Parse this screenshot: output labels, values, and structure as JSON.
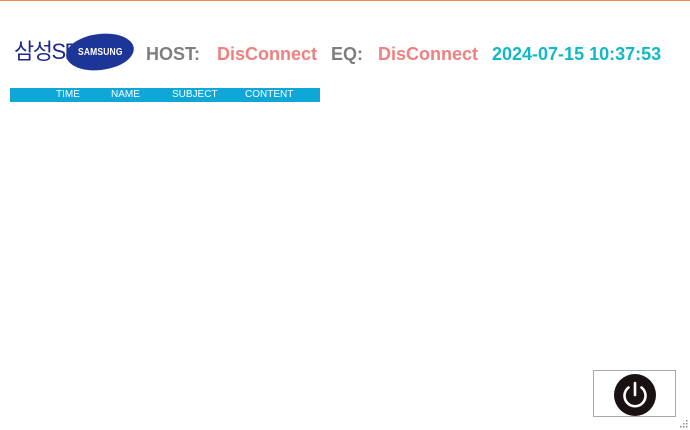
{
  "logos": {
    "company_logo_text": "삼성SDI",
    "brand_logo_text": "SAMSUNG"
  },
  "status": {
    "host_label": "HOST:",
    "host_value": "DisConnect",
    "eq_label": "EQ:",
    "eq_value": "DisConnect",
    "datetime": "2024-07-15 10:37:53"
  },
  "log_table": {
    "columns": [
      "TIME",
      "NAME",
      "SUBJECT",
      "CONTENT"
    ],
    "rows": []
  },
  "controls": {
    "power_icon": "power-icon"
  },
  "colors": {
    "accent_border": "#f08a50",
    "disconnected": "#f08080",
    "datetime": "#12b8c8",
    "table_header": "#0fa7d8",
    "label_gray": "#7f7f7f",
    "logo_blue": "#1d3597"
  }
}
